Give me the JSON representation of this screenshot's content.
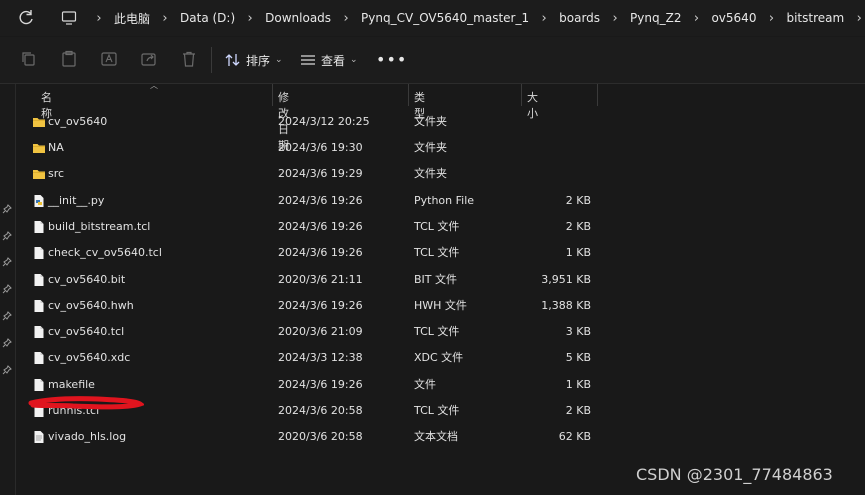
{
  "breadcrumb": [
    "此电脑",
    "Data (D:)",
    "Downloads",
    "Pynq_CV_OV5640_master_1",
    "boards",
    "Pynq_Z2",
    "ov5640",
    "bitstream"
  ],
  "toolbar": {
    "sort_label": "排序",
    "view_label": "查看",
    "more_label": "•••"
  },
  "columns": {
    "name": "名称",
    "date": "修改日期",
    "type": "类型",
    "size": "大小"
  },
  "files": [
    {
      "name": "cv_ov5640",
      "date": "2024/3/12 20:25",
      "type": "文件夹",
      "size": "",
      "icon": "folder-icon"
    },
    {
      "name": "NA",
      "date": "2024/3/6 19:30",
      "type": "文件夹",
      "size": "",
      "icon": "folder-icon"
    },
    {
      "name": "src",
      "date": "2024/3/6 19:29",
      "type": "文件夹",
      "size": "",
      "icon": "folder-icon"
    },
    {
      "name": "__init__.py",
      "date": "2024/3/6 19:26",
      "type": "Python File",
      "size": "2 KB",
      "icon": "python-file-icon"
    },
    {
      "name": "build_bitstream.tcl",
      "date": "2024/3/6 19:26",
      "type": "TCL 文件",
      "size": "2 KB",
      "icon": "file-icon"
    },
    {
      "name": "check_cv_ov5640.tcl",
      "date": "2024/3/6 19:26",
      "type": "TCL 文件",
      "size": "1 KB",
      "icon": "file-icon"
    },
    {
      "name": "cv_ov5640.bit",
      "date": "2020/3/6 21:11",
      "type": "BIT 文件",
      "size": "3,951 KB",
      "icon": "file-icon"
    },
    {
      "name": "cv_ov5640.hwh",
      "date": "2024/3/6 19:26",
      "type": "HWH 文件",
      "size": "1,388 KB",
      "icon": "file-icon"
    },
    {
      "name": "cv_ov5640.tcl",
      "date": "2020/3/6 21:09",
      "type": "TCL 文件",
      "size": "3 KB",
      "icon": "file-icon"
    },
    {
      "name": "cv_ov5640.xdc",
      "date": "2024/3/3 12:38",
      "type": "XDC 文件",
      "size": "5 KB",
      "icon": "file-icon"
    },
    {
      "name": "makefile",
      "date": "2024/3/6 19:26",
      "type": "文件",
      "size": "1 KB",
      "icon": "file-icon"
    },
    {
      "name": "runhls.tcl",
      "date": "2024/3/6 20:58",
      "type": "TCL 文件",
      "size": "2 KB",
      "icon": "file-icon"
    },
    {
      "name": "vivado_hls.log",
      "date": "2020/3/6 20:58",
      "type": "文本文档",
      "size": "62 KB",
      "icon": "text-file-icon"
    }
  ],
  "watermark": "CSDN @2301_77484863",
  "colors": {
    "background": "#191919",
    "folder": "#f0c341",
    "annotation": "#e0141e"
  }
}
